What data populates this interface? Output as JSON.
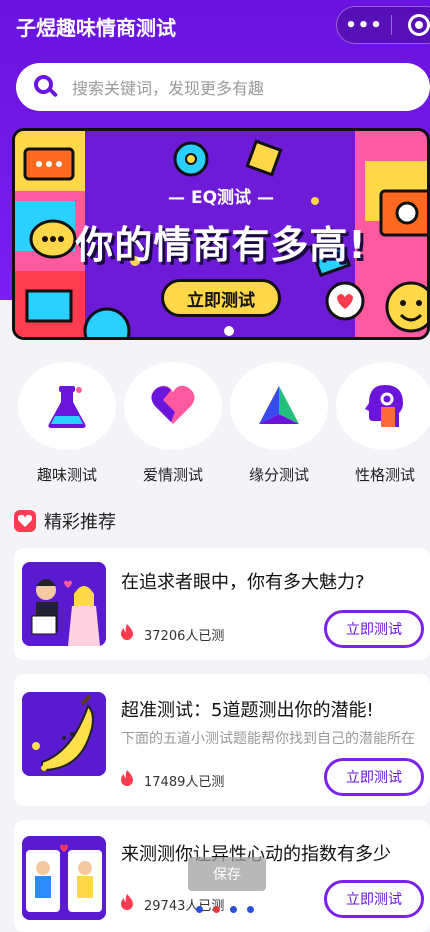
{
  "app": {
    "title": "子煜趣味情商测试"
  },
  "capsule": {
    "more_label": "•••"
  },
  "search": {
    "placeholder": "搜索关键词，发现更多有趣"
  },
  "banner": {
    "eq_label": "— EQ测试 —",
    "headline": "你的情商有多高!",
    "button_label": "立即测试"
  },
  "categories": [
    {
      "label": "趣味测试",
      "icon": "flask-icon"
    },
    {
      "label": "爱情测试",
      "icon": "heart-icon"
    },
    {
      "label": "缘分测试",
      "icon": "triangle-icon"
    },
    {
      "label": "性格测试",
      "icon": "head-icon"
    }
  ],
  "section": {
    "title": "精彩推荐"
  },
  "cards": [
    {
      "title": "在追求者眼中，你有多大魅力?",
      "description": "",
      "count": "37206人已测",
      "button_label": "立即测试"
    },
    {
      "title": "超准测试：5道题测出你的潜能!",
      "description": "下面的五道小测试题能帮你找到自己的潜能所在",
      "count": "17489人已测",
      "button_label": "立即测试"
    },
    {
      "title": "来测测你让异性心动的指数有多少",
      "description": "",
      "count": "29743人已测",
      "button_label": "立即测试"
    }
  ],
  "toast": {
    "label": "保存"
  },
  "colors": {
    "primary": "#6a12e0",
    "accent_red": "#ff3b4f",
    "banner_button": "#ffd84a"
  }
}
